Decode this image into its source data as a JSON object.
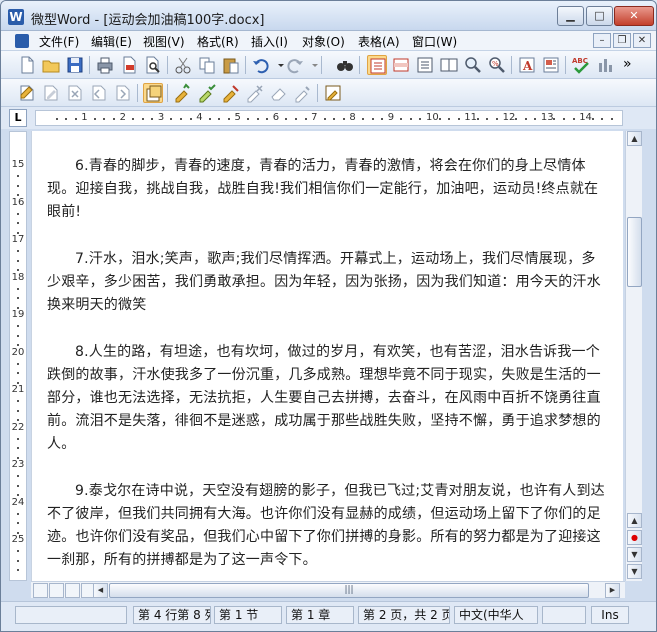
{
  "window": {
    "app_icon_letter": "W",
    "title": "微型Word - [运动会加油稿100字.docx]",
    "minimize_glyph": "▁",
    "maximize_glyph": "□",
    "close_glyph": "✕"
  },
  "menu": {
    "items": [
      "文件(F)",
      "编辑(E)",
      "视图(V)",
      "格式(R)",
      "插入(I)",
      "对象(O)",
      "表格(A)",
      "窗口(W)"
    ],
    "mdi_min": "–",
    "mdi_restore": "❐",
    "mdi_close": "✕"
  },
  "toolbar": {
    "overflow_glyph": "»"
  },
  "ruler": {
    "tab_selector": "L",
    "numbers": [
      "1",
      "2",
      "3",
      "4",
      "5",
      "6",
      "7",
      "8",
      "9",
      "10",
      "11",
      "12",
      "13",
      "14"
    ],
    "vertical_numbers": [
      "15",
      "16",
      "17",
      "18",
      "19",
      "20",
      "21",
      "22",
      "23",
      "24",
      "25"
    ]
  },
  "document": {
    "lines": [
      "6.青春的脚步，青春的速度，青春的活力，青春的激情，将会在你们的身上尽情体",
      "现。迎接自我，挑战自我，战胜自我!我们相信你们一定能行，加油吧，运动员!终点就在",
      "眼前!",
      "",
      "7.汗水，泪水;笑声，歌声;我们尽情挥洒。开幕式上，运动场上，我们尽情展现，多",
      "少艰辛，多少困苦，我们勇敢承担。因为年轻，因为张扬，因为我们知道：用今天的汗水",
      "换来明天的微笑",
      "",
      "8.人生的路，有坦途，也有坎坷，做过的岁月，有欢笑，也有苦涩，泪水告诉我一个",
      "跌倒的故事，汗水使我多了一份沉重，几多成熟。理想毕竟不同于现实，失败是生活的一",
      "部分，谁也无法选择，无法抗拒，人生要自己去拼搏，去奋斗，在风雨中百折不饶勇往直",
      "前。流泪不是失落，徘徊不是迷惑，成功属于那些战胜失败，坚持不懈，勇于追求梦想的",
      "人。",
      "",
      "9.泰戈尔在诗中说，天空没有翅膀的影子，但我已飞过;艾青对朋友说，也许有人到达",
      "不了彼岸，但我们共同拥有大海。也许你们没有显赫的成绩，但运动场上留下了你们的足",
      "迹。也许你们没有奖品，但我们心中留下了你们拼搏的身影。所有的努力都是为了迎接这",
      "一刹那，所有的拼搏都是为了这一声令下。"
    ]
  },
  "scrollbar": {
    "up_glyph": "▲",
    "down_glyph": "▼",
    "left_glyph": "◀",
    "right_glyph": "▶",
    "thumb_grip": "|||"
  },
  "status": {
    "position": "第 4 行第 8 列",
    "section": "第 1 节",
    "chapter": "第 1 章",
    "page": "第 2 页，共 2 页",
    "language": "中文(中华人",
    "mode": "Ins"
  }
}
